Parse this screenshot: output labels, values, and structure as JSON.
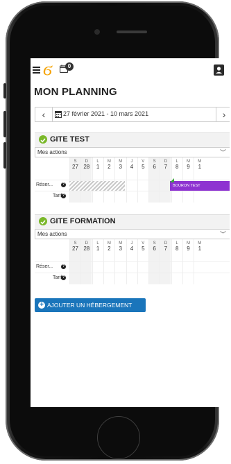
{
  "app": {
    "logo_glyph": "ϭ",
    "notification_count": "0",
    "page_title": "MON PLANNING",
    "date_range": "27 février 2021 - 10 mars 2021",
    "colors": {
      "accent": "#1a75bb",
      "logo": "#f5a300",
      "booking": "#8e33d1",
      "check": "#7ab829"
    }
  },
  "days": [
    {
      "dow": "S",
      "num": "27",
      "weekend": true
    },
    {
      "dow": "D",
      "num": "28",
      "weekend": true
    },
    {
      "dow": "L",
      "num": "1",
      "weekend": false
    },
    {
      "dow": "M",
      "num": "2",
      "weekend": false
    },
    {
      "dow": "M",
      "num": "3",
      "weekend": false
    },
    {
      "dow": "J",
      "num": "4",
      "weekend": false
    },
    {
      "dow": "V",
      "num": "5",
      "weekend": false
    },
    {
      "dow": "S",
      "num": "6",
      "weekend": true
    },
    {
      "dow": "D",
      "num": "7",
      "weekend": true
    },
    {
      "dow": "L",
      "num": "8",
      "weekend": false
    },
    {
      "dow": "M",
      "num": "9",
      "weekend": false
    },
    {
      "dow": "M",
      "num": "1",
      "weekend": false
    }
  ],
  "gites": [
    {
      "name": "GITE TEST",
      "actions": "Mes actions",
      "rows": [
        {
          "label": "Réser...",
          "help": "?"
        },
        {
          "label": "Tarif",
          "help": "?"
        }
      ],
      "booking": "BOURON TEST"
    },
    {
      "name": "GITE FORMATION",
      "actions": "Mes actions",
      "rows": [
        {
          "label": "Réser...",
          "help": "?"
        },
        {
          "label": "Tarif",
          "help": "?"
        }
      ]
    }
  ],
  "add_button": "AJOUTER UN HÉBERGEMENT"
}
